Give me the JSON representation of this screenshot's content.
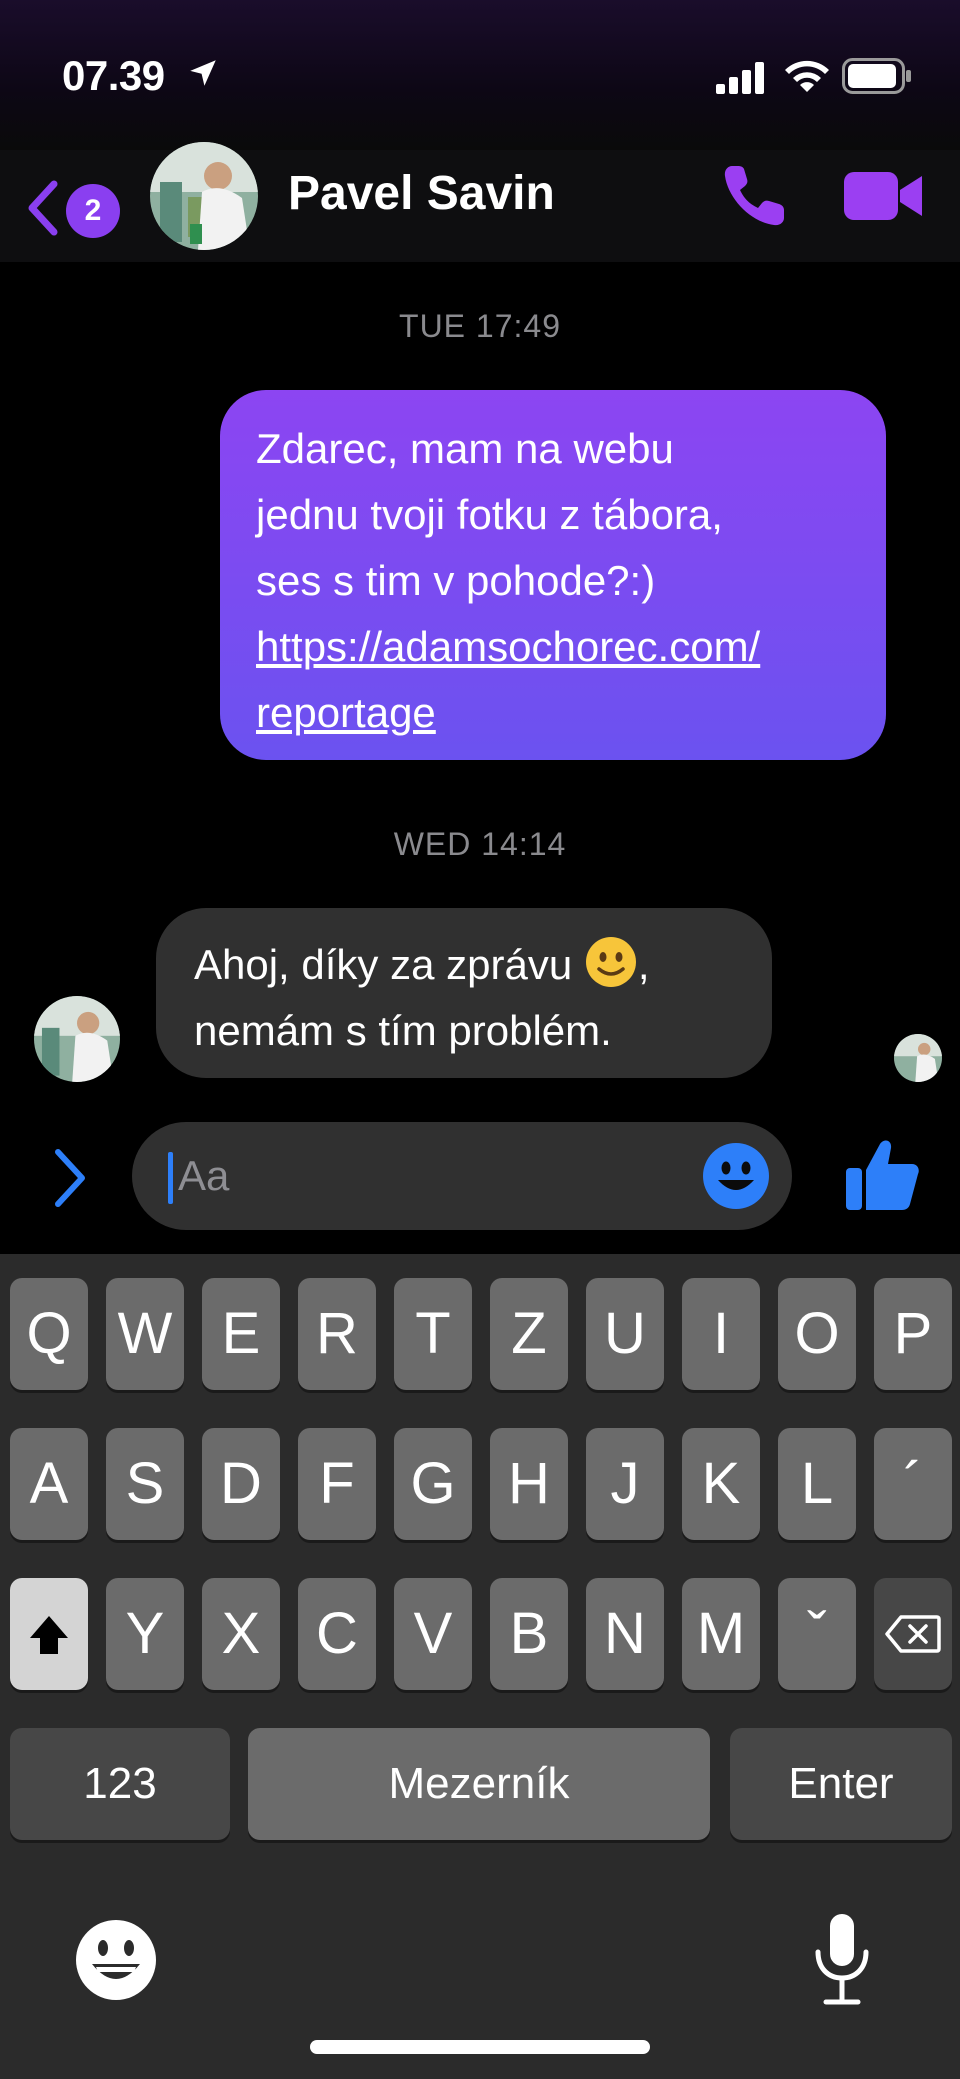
{
  "status_bar": {
    "time": "07.39"
  },
  "header": {
    "back_badge": "2",
    "contact_name": "Pavel Savin",
    "icons": [
      "location-arrow-icon",
      "signal-icon",
      "wifi-icon",
      "battery-icon",
      "back-chevron-icon",
      "phone-icon",
      "video-call-icon"
    ]
  },
  "conversation": {
    "timestamp_1": "TUE 17:49",
    "outgoing_message": {
      "line1": "Zdarec, mam na webu",
      "line2": "jednu tvoji fotku z tábora,",
      "line3": "ses s tim v pohode?:)",
      "link_line1": "https://adamsochorec.com/",
      "link_line2": "reportage"
    },
    "timestamp_2": "WED 14:14",
    "incoming_message": {
      "line1": "Ahoj, díky za zprávu",
      "line1_suffix": ",",
      "line2": "nemám s tím problém."
    }
  },
  "composer": {
    "placeholder": "Aa",
    "icons": [
      "expand-chevron-icon",
      "emoji-icon",
      "thumbs-up-icon"
    ]
  },
  "keyboard": {
    "row1": [
      "Q",
      "W",
      "E",
      "R",
      "T",
      "Z",
      "U",
      "I",
      "O",
      "P"
    ],
    "row2": [
      "A",
      "S",
      "D",
      "F",
      "G",
      "H",
      "J",
      "K",
      "L",
      "´"
    ],
    "row3": [
      "Y",
      "X",
      "C",
      "V",
      "B",
      "N",
      "M",
      "ˇ"
    ],
    "numbers_key": "123",
    "space_key": "Mezerník",
    "enter_key": "Enter",
    "icons": [
      "shift-icon",
      "backspace-icon",
      "keyboard-emoji-icon",
      "microphone-icon"
    ]
  },
  "colors": {
    "accent_purple": "#8a3ff0",
    "outgoing_bubble_top": "#8c45f2",
    "outgoing_bubble_bottom": "#6b52f0",
    "incoming_bubble": "#303030",
    "composer_blue": "#2d7ff9"
  }
}
